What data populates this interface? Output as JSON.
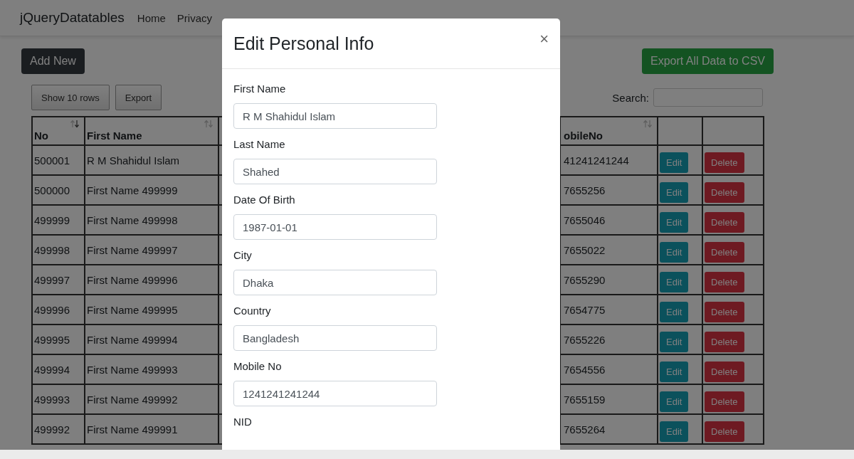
{
  "navbar": {
    "brand": "jQueryDatatables",
    "links": [
      "Home",
      "Privacy"
    ]
  },
  "toolbar": {
    "add_button": "Add New",
    "export_button": "Export All Data to CSV"
  },
  "table_controls": {
    "buttons": [
      "Show 10 rows",
      "Export"
    ],
    "search_label": "Search:"
  },
  "table": {
    "columns": [
      {
        "label": "No",
        "sorted": true
      },
      {
        "label": "First Name",
        "sorted": false
      },
      {
        "label": "obileNo",
        "sorted": false
      }
    ],
    "rows": [
      {
        "no": "500001",
        "first_name": "R M Shahidul Islam",
        "mobile_no": "41241241244",
        "edit": "Edit",
        "delete": "Delete"
      },
      {
        "no": "500000",
        "first_name": "First Name 499999",
        "mobile_no": "7655256",
        "edit": "Edit",
        "delete": "Delete"
      },
      {
        "no": "499999",
        "first_name": "First Name 499998",
        "mobile_no": "7655046",
        "edit": "Edit",
        "delete": "Delete"
      },
      {
        "no": "499998",
        "first_name": "First Name 499997",
        "mobile_no": "7655022",
        "edit": "Edit",
        "delete": "Delete"
      },
      {
        "no": "499997",
        "first_name": "First Name 499996",
        "mobile_no": "7655290",
        "edit": "Edit",
        "delete": "Delete"
      },
      {
        "no": "499996",
        "first_name": "First Name 499995",
        "mobile_no": "7654775",
        "edit": "Edit",
        "delete": "Delete"
      },
      {
        "no": "499995",
        "first_name": "First Name 499994",
        "mobile_no": "7655226",
        "edit": "Edit",
        "delete": "Delete"
      },
      {
        "no": "499994",
        "first_name": "First Name 499993",
        "mobile_no": "7654556",
        "edit": "Edit",
        "delete": "Delete"
      },
      {
        "no": "499993",
        "first_name": "First Name 499992",
        "mobile_no": "7655159",
        "edit": "Edit",
        "delete": "Delete"
      },
      {
        "no": "499992",
        "first_name": "First Name 499991",
        "mobile_no": "7655264",
        "edit": "Edit",
        "delete": "Delete"
      }
    ]
  },
  "modal": {
    "title": "Edit Personal Info",
    "close": "×",
    "fields": [
      {
        "label": "First Name",
        "value": "R M Shahidul Islam"
      },
      {
        "label": "Last Name",
        "value": "Shahed"
      },
      {
        "label": "Date Of Birth",
        "value": "1987-01-01"
      },
      {
        "label": "City",
        "value": "Dhaka"
      },
      {
        "label": "Country",
        "value": "Bangladesh"
      },
      {
        "label": "Mobile No",
        "value": "1241241241244"
      },
      {
        "label": "NID"
      }
    ]
  }
}
